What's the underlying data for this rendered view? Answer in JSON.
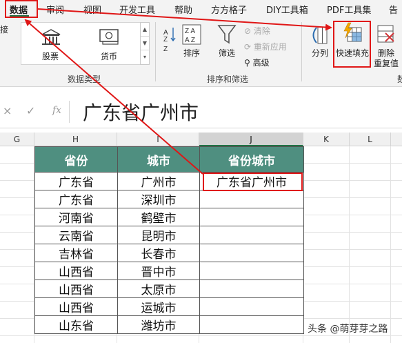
{
  "menu": {
    "tabs": [
      "数据",
      "审阅",
      "视图",
      "开发工具",
      "帮助",
      "方方格子",
      "DIY工具箱",
      "PDF工具集",
      "告"
    ],
    "active_tab": "数据",
    "edge_glyph": "接"
  },
  "ribbon": {
    "data_types": {
      "stocks_label": "股票",
      "currency_label": "货币",
      "group_label": "数据类型"
    },
    "sort_filter": {
      "sort_label": "排序",
      "filter_label": "筛选",
      "clear_label": "清除",
      "reapply_label": "重新应用",
      "advanced_label": "高级",
      "group_label": "排序和筛选"
    },
    "data_tools": {
      "split_label": "分列",
      "flash_fill_label": "快速填充",
      "remove_dup_label_1": "删除",
      "remove_dup_label_2": "重复值",
      "group_label_partial": "数"
    }
  },
  "formula_bar": {
    "cancel_glyph": "×",
    "enter_glyph": "✓",
    "fx_glyph": "fx",
    "content": "广东省广州市"
  },
  "columns": [
    "G",
    "H",
    "I",
    "J",
    "K",
    "L"
  ],
  "active_column": "J",
  "table": {
    "headers": [
      "省份",
      "城市",
      "省份城市"
    ],
    "rows": [
      [
        "广东省",
        "广州市",
        "广东省广州市"
      ],
      [
        "广东省",
        "深圳市",
        ""
      ],
      [
        "河南省",
        "鹤壁市",
        ""
      ],
      [
        "云南省",
        "昆明市",
        ""
      ],
      [
        "吉林省",
        "长春市",
        ""
      ],
      [
        "山西省",
        "晋中市",
        ""
      ],
      [
        "山西省",
        "太原市",
        ""
      ],
      [
        "山西省",
        "运城市",
        ""
      ],
      [
        "山东省",
        "潍坊市",
        ""
      ]
    ]
  },
  "watermark": "头条 @萌芽芽之路",
  "colors": {
    "accent": "#217346",
    "table_header": "#4f8f80",
    "annotation_red": "#e01616",
    "flash_fill_yellow": "#f2a900"
  }
}
